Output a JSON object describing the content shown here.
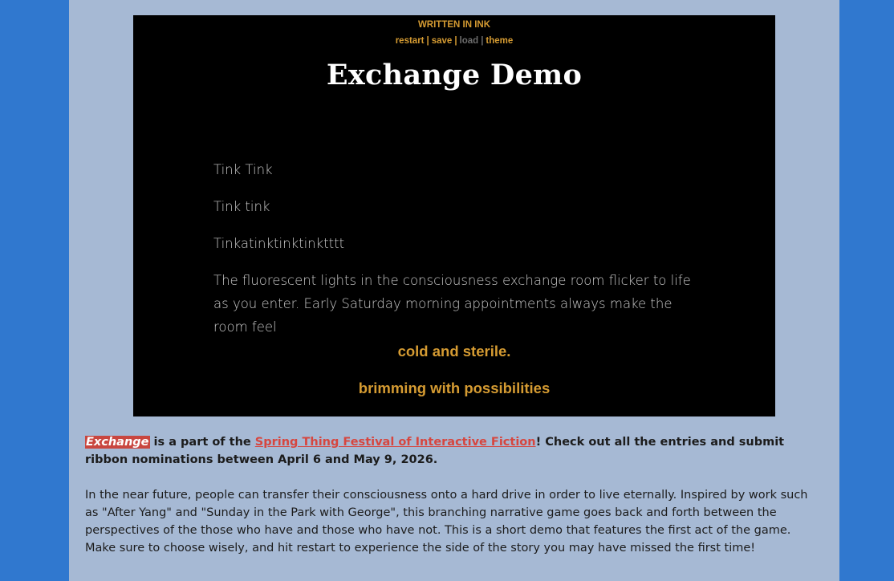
{
  "header": {
    "written_in": "WRITTEN IN INK",
    "menu": {
      "restart": "restart",
      "save": "save",
      "load": "load",
      "theme": "theme",
      "separator": "|"
    },
    "title": "Exchange Demo"
  },
  "story": {
    "paragraphs": [
      "Tink Tink",
      "Tink tink",
      "Tinkatinktinktinktttt",
      "The fluorescent lights in the consciousness exchange room flicker to life as you enter. Early Saturday morning appointments always make the room feel"
    ]
  },
  "choices": [
    "cold and sterile.",
    "brimming with possibilities"
  ],
  "info": {
    "game_tag": "Exchange",
    "part_of": " is a part of the ",
    "festival_link": "Spring Thing Festival of Interactive Fiction",
    "festival_rest": "! Check out all the entries and submit ribbon nominations between April 6 and May 9, 2026.",
    "description": "In the near future, people can transfer their consciousness onto a hard drive in order to live eternally. Inspired by work such as \"After Yang\" and \"Sunday in the Park with George\", this branching narrative game goes back and forth between the perspectives of the those who have and those who have not. This is a short demo that features the first act of the game. Make sure to choose wisely, and hit restart to experience the side of the story you may have missed the first time!"
  },
  "colors": {
    "page_background": "#3078cf",
    "column_background": "#a6b9d4",
    "game_background": "#000000",
    "accent": "#d59b32",
    "story_text": "#c9c9c9",
    "link": "#d6463f",
    "tag_background": "#c9463f"
  }
}
